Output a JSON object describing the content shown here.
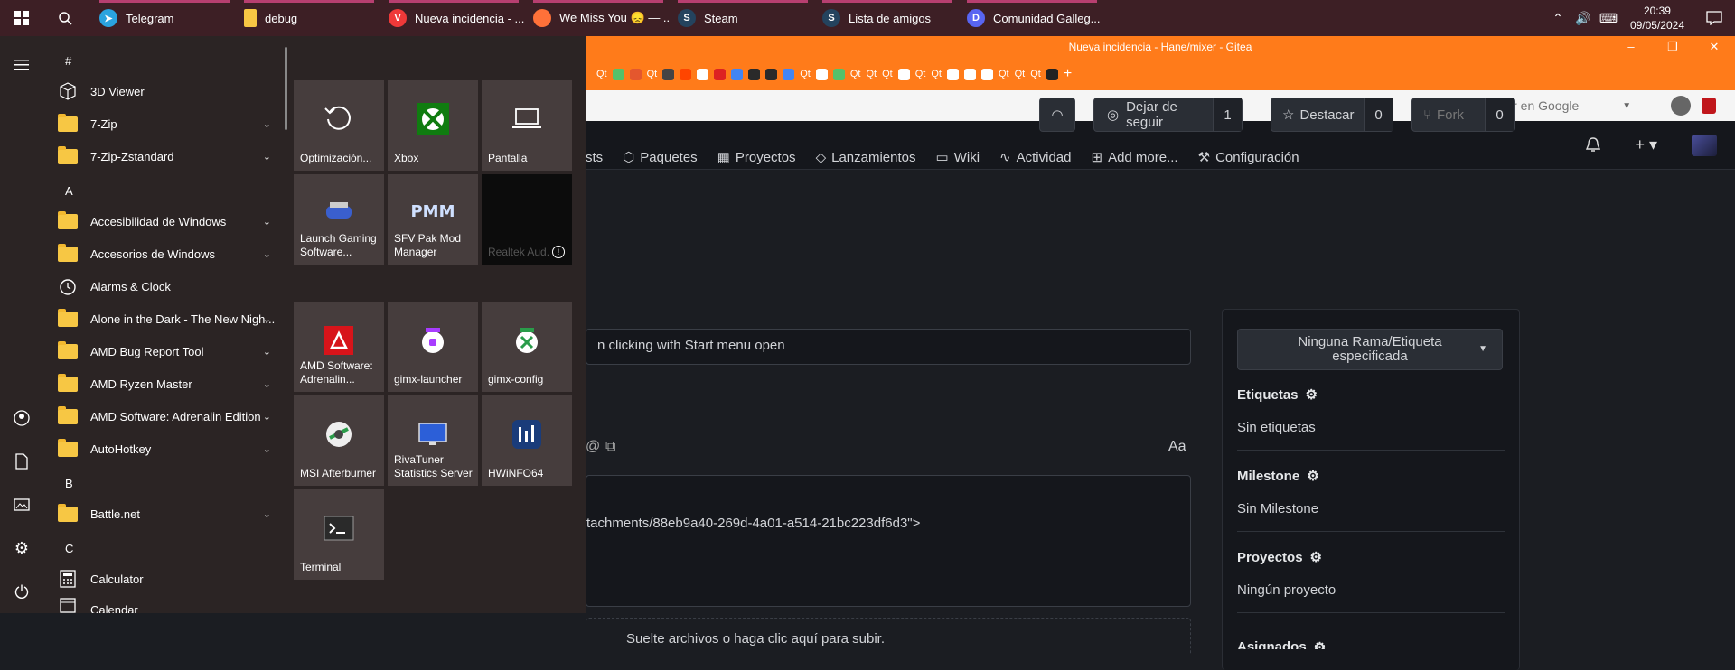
{
  "taskbar": {
    "tasks": [
      {
        "label": "Telegram",
        "icon": "telegram-icon",
        "color": "#2aa3df"
      },
      {
        "label": "debug",
        "icon": "folder-icon",
        "color": "#f7c744"
      },
      {
        "label": "Nueva incidencia - ...",
        "icon": "vivaldi-icon",
        "color": "#ef3939"
      },
      {
        "label": "We Miss You 😞 — ...",
        "icon": "firefox-icon",
        "color": "#ff7139"
      },
      {
        "label": "Steam",
        "icon": "steam-icon",
        "color": "#1b2838"
      },
      {
        "label": "Lista de amigos",
        "icon": "steam-icon",
        "color": "#1b2838"
      },
      {
        "label": "Comunidad Galleg...",
        "icon": "discord-icon",
        "color": "#5865f2"
      }
    ],
    "time": "20:39",
    "date": "09/05/2024"
  },
  "browser": {
    "window_title": "Nueva incidencia - Hane/mixer - Gitea",
    "tab_labels": [
      "Qt",
      "Qt",
      "Qt",
      "Qt",
      "Qt",
      "Qt",
      "Qt",
      "Qt",
      "Qt",
      "Qt",
      "Qt",
      "Qt"
    ],
    "search_placeholder": "Buscar en Google",
    "accent": "#ff7b1a"
  },
  "gitea": {
    "unfollow_label": "Dejar de seguir",
    "unfollow_count": "1",
    "star_label": "Destacar",
    "star_count": "0",
    "fork_label": "Fork",
    "fork_count": "0",
    "nav": [
      "sts",
      "Paquetes",
      "Proyectos",
      "Lanzamientos",
      "Wiki",
      "Actividad",
      "Add more...",
      "Configuración"
    ],
    "title_value": "n clicking with Start menu open",
    "font_toggle": "Aa",
    "body_snippet": "tachments/88eb9a40-269d-4a01-a514-21bc223df6d3\">",
    "dropzone": "Suelte archivos o haga clic aquí para subir.",
    "branch_selector": "Ninguna Rama/Etiqueta especificada",
    "sidebar": [
      {
        "head": "Etiquetas",
        "value": "Sin etiquetas"
      },
      {
        "head": "Milestone",
        "value": "Sin Milestone"
      },
      {
        "head": "Proyectos",
        "value": "Ningún proyecto"
      },
      {
        "head": "Asignados",
        "value": ""
      }
    ]
  },
  "startmenu": {
    "apps": [
      {
        "type": "letter",
        "label": "#"
      },
      {
        "type": "app",
        "label": "3D Viewer",
        "icon": "cube-icon"
      },
      {
        "type": "folder",
        "label": "7-Zip"
      },
      {
        "type": "folder",
        "label": "7-Zip-Zstandard"
      },
      {
        "type": "letter",
        "label": "A"
      },
      {
        "type": "folder",
        "label": "Accesibilidad de Windows"
      },
      {
        "type": "folder",
        "label": "Accesorios de Windows"
      },
      {
        "type": "app",
        "label": "Alarms & Clock",
        "icon": "alarm-clock-icon"
      },
      {
        "type": "folder",
        "label": "Alone in the Dark - The New Nigh..."
      },
      {
        "type": "folder",
        "label": "AMD Bug Report Tool"
      },
      {
        "type": "folder",
        "label": "AMD Ryzen Master"
      },
      {
        "type": "folder",
        "label": "AMD Software: Adrenalin Edition"
      },
      {
        "type": "folder",
        "label": "AutoHotkey"
      },
      {
        "type": "letter",
        "label": "B"
      },
      {
        "type": "folder",
        "label": "Battle.net"
      },
      {
        "type": "letter",
        "label": "C"
      },
      {
        "type": "app",
        "label": "Calculator",
        "icon": "calculator-icon"
      },
      {
        "type": "app",
        "label": "Calendar",
        "icon": "calendar-icon"
      }
    ],
    "tiles": [
      {
        "label": "Optimización...",
        "icon": "refresh-icon"
      },
      {
        "label": "Xbox",
        "icon": "xbox-icon"
      },
      {
        "label": "Pantalla",
        "icon": "laptop-icon"
      },
      {
        "label": "Launch Gaming Software...",
        "icon": "gaming-icon"
      },
      {
        "label": "SFV Pak Mod Manager",
        "icon": "pmm-icon"
      },
      {
        "label": "Realtek Aud...",
        "icon": "info-icon"
      },
      {
        "label": "AMD Software: Adrenalin...",
        "icon": "amd-icon"
      },
      {
        "label": "gimx-launcher",
        "icon": "gimx-icon"
      },
      {
        "label": "gimx-config",
        "icon": "gimx-config-icon"
      },
      {
        "label": "MSI Afterburner",
        "icon": "msi-icon"
      },
      {
        "label": "RivaTuner Statistics Server",
        "icon": "rivatuner-icon"
      },
      {
        "label": "HWiNFO64",
        "icon": "hwinfo-icon"
      },
      {
        "label": "Terminal",
        "icon": "terminal-icon"
      }
    ]
  }
}
